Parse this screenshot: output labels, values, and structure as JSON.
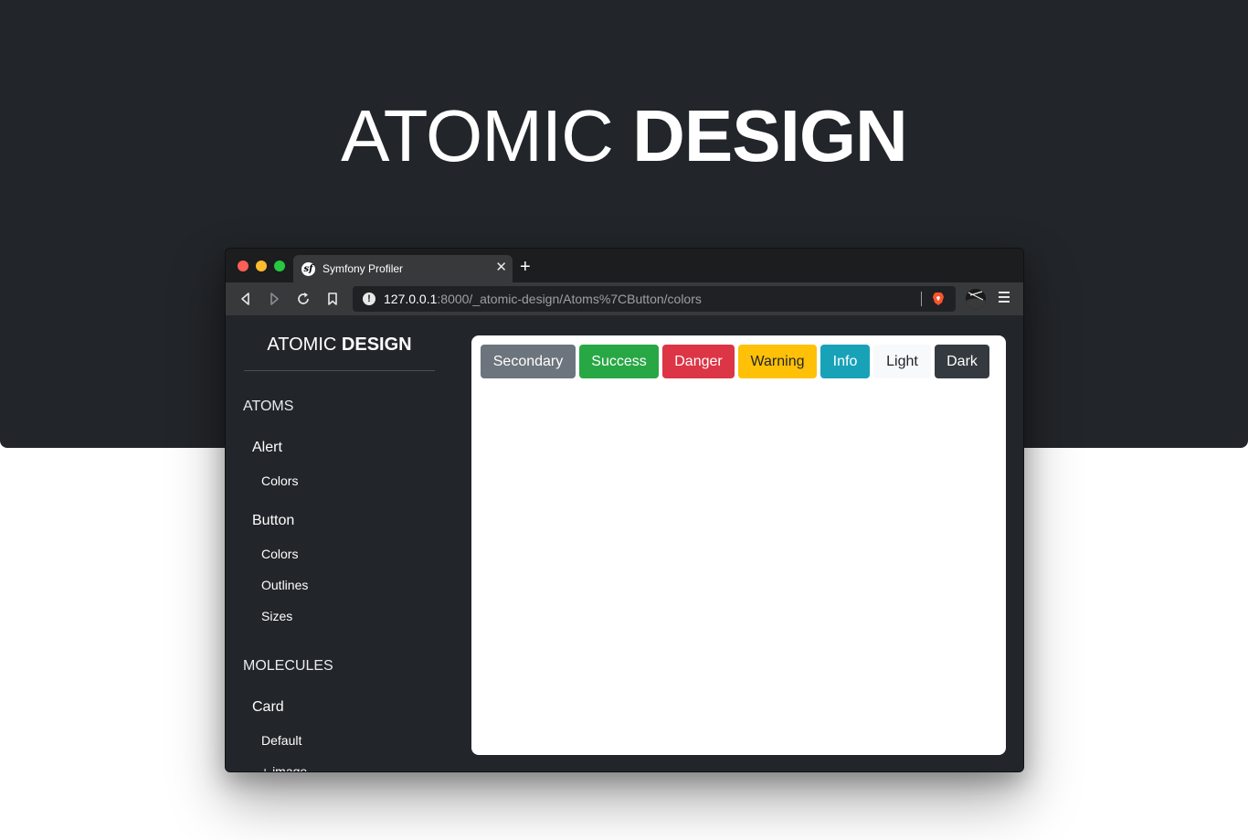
{
  "hero": {
    "title_light": "ATOMIC",
    "title_bold": "DESIGN"
  },
  "browser": {
    "tab": {
      "favicon": "sf",
      "title": "Symfony Profiler",
      "close": "✕"
    },
    "new_tab": "+",
    "url": {
      "host": "127.0.0.1",
      "path": ":8000/_atomic-design/Atoms%7CButton/colors"
    },
    "icons": [
      "back-icon",
      "forward-icon",
      "reload-icon",
      "bookmark-icon",
      "info-icon",
      "brave-shield-icon",
      "profile-icon",
      "menu-icon"
    ]
  },
  "sidebar": {
    "brand_light": "ATOMIC",
    "brand_bold": "DESIGN",
    "sections": [
      {
        "label": "ATOMS",
        "groups": [
          {
            "label": "Alert",
            "items": [
              "Colors"
            ]
          },
          {
            "label": "Button",
            "items": [
              "Colors",
              "Outlines",
              "Sizes"
            ]
          }
        ]
      },
      {
        "label": "MOLECULES",
        "groups": [
          {
            "label": "Card",
            "items": [
              "Default",
              "+ image"
            ]
          }
        ]
      }
    ]
  },
  "buttons": {
    "secondary": "Secondary",
    "success": "Success",
    "danger": "Danger",
    "warning": "Warning",
    "info": "Info",
    "light": "Light",
    "dark": "Dark"
  },
  "colors": {
    "hero_bg": "#222529",
    "secondary": "#6c757d",
    "success": "#28a745",
    "danger": "#dc3545",
    "warning": "#ffc107",
    "info": "#17a2b8",
    "light": "#f8f9fa",
    "dark": "#343a40"
  }
}
